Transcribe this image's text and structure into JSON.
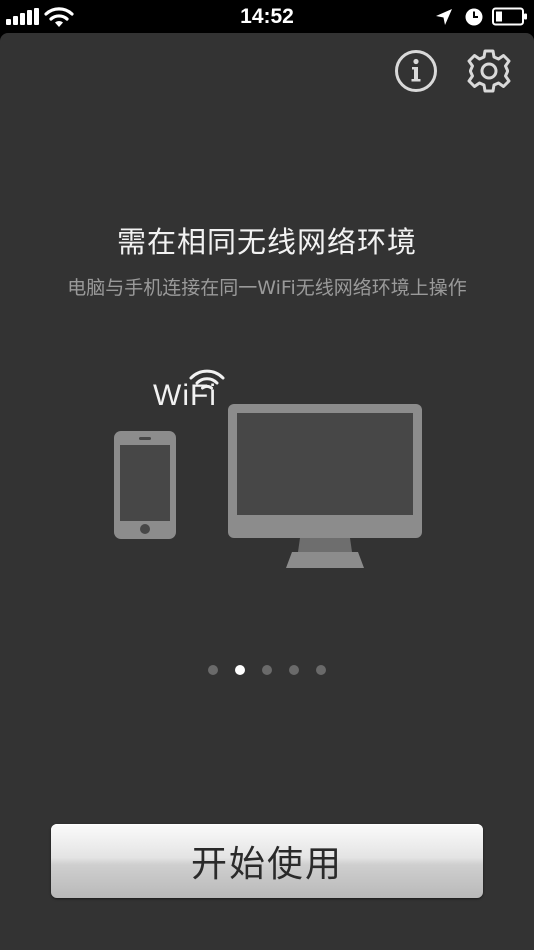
{
  "status_bar": {
    "time": "14:52",
    "icons": [
      "signal-icon",
      "wifi-icon",
      "location-arrow-icon",
      "clock-icon",
      "battery-icon"
    ]
  },
  "header": {
    "info_icon": "info-icon",
    "settings_icon": "gear-icon"
  },
  "onboarding": {
    "title": "需在相同无线网络环境",
    "subtitle": "电脑与手机连接在同一WiFi无线网络环境上操作",
    "wifi_label": "WiFi",
    "page_count": 5,
    "active_page": 2
  },
  "start_button": {
    "label": "开始使用"
  },
  "colors": {
    "background": "#333333",
    "device_gray": "#8c8c8c",
    "screen_dark": "#474747",
    "dot_active": "#ffffff",
    "dot_inactive": "#6a6a6a"
  }
}
